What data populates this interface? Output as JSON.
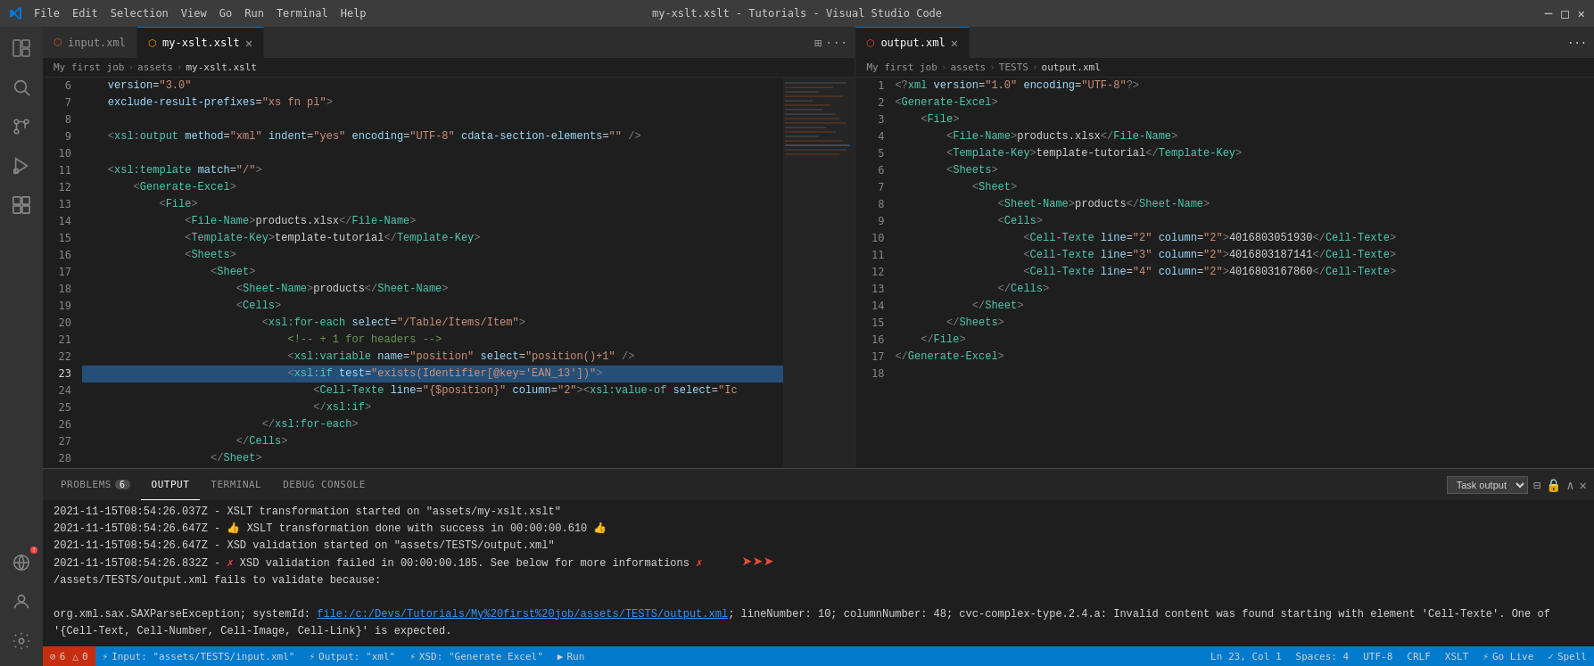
{
  "titleBar": {
    "title": "my-xslt.xslt - Tutorials - Visual Studio Code",
    "menu": [
      "File",
      "Edit",
      "Selection",
      "View",
      "Go",
      "Run",
      "Terminal",
      "Help"
    ],
    "controls": [
      "─",
      "□",
      "✕"
    ]
  },
  "leftEditor": {
    "tabs": [
      {
        "id": "input-xml",
        "label": "input.xml",
        "icon": "xml",
        "active": false,
        "dirty": false
      },
      {
        "id": "my-xslt",
        "label": "my-xslt.xslt",
        "icon": "xslt",
        "active": true,
        "dirty": false
      }
    ],
    "breadcrumb": [
      "My first job",
      "assets",
      "my-xslt.xslt"
    ],
    "lines": [
      {
        "num": 6,
        "content": "    version=\"3.0\""
      },
      {
        "num": 7,
        "content": "    exclude-result-prefixes=\"xs fn pl\">"
      },
      {
        "num": 8,
        "content": ""
      },
      {
        "num": 9,
        "content": "    <xsl:output method=\"xml\" indent=\"yes\" encoding=\"UTF-8\" cdata-section-elements=\"\" />"
      },
      {
        "num": 10,
        "content": ""
      },
      {
        "num": 11,
        "content": "    <xsl:template match=\"/\">"
      },
      {
        "num": 12,
        "content": "        <Generate-Excel>"
      },
      {
        "num": 13,
        "content": "            <File>"
      },
      {
        "num": 14,
        "content": "                <File-Name>products.xlsx</File-Name>"
      },
      {
        "num": 15,
        "content": "                <Template-Key>template-tutorial</Template-Key>"
      },
      {
        "num": 16,
        "content": "                <Sheets>"
      },
      {
        "num": 17,
        "content": "                    <Sheet>"
      },
      {
        "num": 18,
        "content": "                        <Sheet-Name>products</Sheet-Name>"
      },
      {
        "num": 19,
        "content": "                        <Cells>"
      },
      {
        "num": 20,
        "content": "                            <xsl:for-each select=\"/Table/Items/Item\">"
      },
      {
        "num": 21,
        "content": "                                <!-- + 1 for headers -->"
      },
      {
        "num": 22,
        "content": "                                <xsl:variable name=\"position\" select=\"position()+1\" />"
      },
      {
        "num": 23,
        "content": "                                <xsl:if test=\"exists(Identifier[@key='EAN_13'])\">"
      },
      {
        "num": 24,
        "content": "                                    <Cell-Texte line=\"{$position}\" column=\"2\"><xsl:value-of select=\"Ic"
      },
      {
        "num": 25,
        "content": "                                    </xsl:if>"
      },
      {
        "num": 26,
        "content": "                            </xsl:for-each>"
      },
      {
        "num": 27,
        "content": "                        </Cells>"
      },
      {
        "num": 28,
        "content": "                    </Sheet>"
      }
    ]
  },
  "rightEditor": {
    "tabs": [
      {
        "id": "output-xml",
        "label": "output.xml",
        "icon": "xml",
        "active": true,
        "dirty": false
      }
    ],
    "breadcrumb": [
      "My first job",
      "assets",
      "TESTS",
      "output.xml"
    ],
    "lines": [
      {
        "num": 1,
        "content": "<?xml version=\"1.0\" encoding=\"UTF-8\"?>"
      },
      {
        "num": 2,
        "content": "<Generate-Excel>"
      },
      {
        "num": 3,
        "content": "    <File>"
      },
      {
        "num": 4,
        "content": "        <File-Name>products.xlsx</File-Name>"
      },
      {
        "num": 5,
        "content": "        <Template-Key>template-tutorial</Template-Key>"
      },
      {
        "num": 6,
        "content": "        <Sheets>"
      },
      {
        "num": 7,
        "content": "            <Sheet>"
      },
      {
        "num": 8,
        "content": "                <Sheet-Name>products</Sheet-Name>"
      },
      {
        "num": 9,
        "content": "                <Cells>"
      },
      {
        "num": 10,
        "content": "                    <Cell-Texte line=\"2\" column=\"2\">4016803051930</Cell-Texte>"
      },
      {
        "num": 11,
        "content": "                    <Cell-Texte line=\"3\" column=\"2\">4016803187141</Cell-Texte>"
      },
      {
        "num": 12,
        "content": "                    <Cell-Texte line=\"4\" column=\"2\">4016803167860</Cell-Texte>"
      },
      {
        "num": 13,
        "content": "                </Cells>"
      },
      {
        "num": 14,
        "content": "            </Sheet>"
      },
      {
        "num": 15,
        "content": "        </Sheets>"
      },
      {
        "num": 16,
        "content": "    </File>"
      },
      {
        "num": 17,
        "content": "</Generate-Excel>"
      },
      {
        "num": 18,
        "content": ""
      }
    ]
  },
  "panel": {
    "tabs": [
      {
        "id": "problems",
        "label": "PROBLEMS",
        "badge": "6",
        "active": false
      },
      {
        "id": "output",
        "label": "OUTPUT",
        "badge": null,
        "active": true
      },
      {
        "id": "terminal",
        "label": "TERMINAL",
        "badge": null,
        "active": false
      },
      {
        "id": "debug",
        "label": "DEBUG CONSOLE",
        "badge": null,
        "active": false
      }
    ],
    "taskOutput": "Task output",
    "lines": [
      "2021-11-15T08:54:26.037Z - XSLT transformation started on \"assets/my-xslt.xslt\"",
      "2021-11-15T08:54:26.647Z - 👍 XSLT transformation done with success in 00:00:00.610 👍",
      "2021-11-15T08:54:26.647Z - XSD validation started on \"assets/TESTS/output.xml\"",
      "2021-11-15T08:54:26.832Z - ✗ XSD validation failed in 00:00:00.185. See below for more informations ✗  ←←←",
      "/assets/TESTS/output.xml fails to validate because:",
      "",
      "org.xml.sax.SAXParseException; systemId: file:/c:/Devs/Tutorials/My%20first%20job/assets/TESTS/output.xml; lineNumber: 10; columnNumber: 48; cvc-complex-type.2.4.a: Invalid content was found starting with element 'Cell-Texte'. One of '{Cell-Text, Cell-Number, Cell-Image, Cell-Link}' is expected."
    ]
  },
  "statusBar": {
    "errors": "6",
    "warnings": "0",
    "left_items": [
      {
        "id": "errors",
        "text": "⊘ 6  △ 0"
      },
      {
        "id": "input",
        "text": "⚡ Input: \"assets/TESTS/input.xml\""
      },
      {
        "id": "output-ref",
        "text": "⚡ Output: \"xml\""
      },
      {
        "id": "xsd",
        "text": "⚡ XSD: \"Generate Excel\""
      },
      {
        "id": "run",
        "text": "▶ Run"
      }
    ],
    "right_items": [
      {
        "id": "ln-col",
        "text": "Ln 23, Col 1"
      },
      {
        "id": "spaces",
        "text": "Spaces: 4"
      },
      {
        "id": "encoding",
        "text": "UTF-8"
      },
      {
        "id": "eol",
        "text": "CRLF"
      },
      {
        "id": "lang",
        "text": "XSLT"
      },
      {
        "id": "golive",
        "text": "⚡ Go Live"
      },
      {
        "id": "spell",
        "text": "✓ Spell"
      }
    ]
  },
  "activityBar": {
    "icons": [
      {
        "id": "explorer",
        "symbol": "🗂",
        "active": false
      },
      {
        "id": "search",
        "symbol": "🔍",
        "active": false
      },
      {
        "id": "source-control",
        "symbol": "⑂",
        "active": false
      },
      {
        "id": "run-debug",
        "symbol": "▷",
        "active": false
      },
      {
        "id": "extensions",
        "symbol": "⊞",
        "active": false
      }
    ],
    "bottom_icons": [
      {
        "id": "remote",
        "symbol": "⌂"
      },
      {
        "id": "account",
        "symbol": "👤"
      },
      {
        "id": "settings",
        "symbol": "⚙"
      }
    ]
  }
}
